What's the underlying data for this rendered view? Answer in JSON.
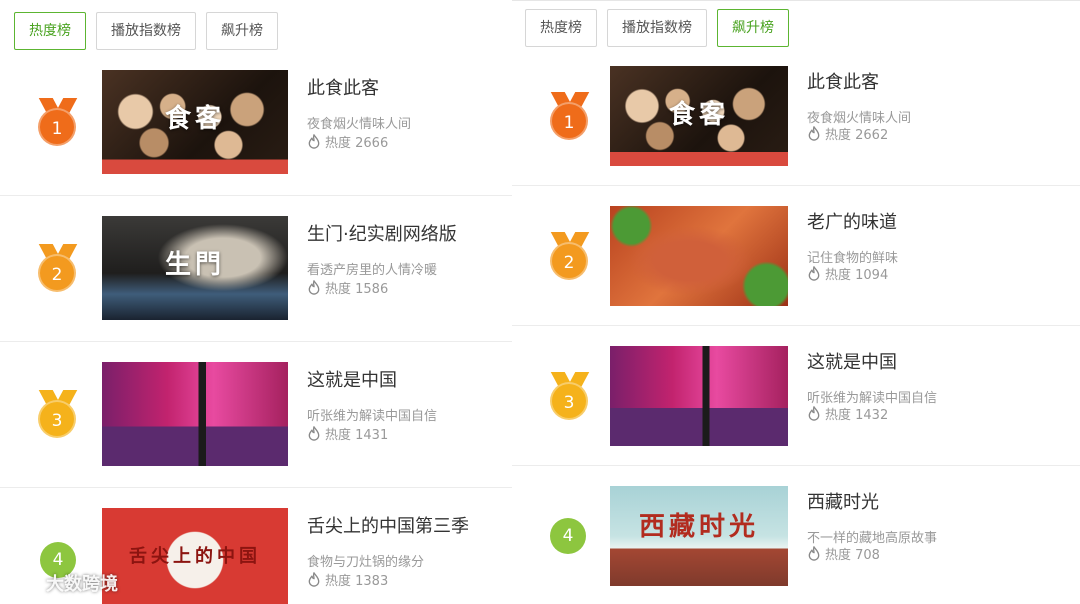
{
  "left_panel": {
    "tabs": [
      {
        "label": "热度榜",
        "active": true
      },
      {
        "label": "播放指数榜",
        "active": false
      },
      {
        "label": "飙升榜",
        "active": false
      }
    ],
    "items": [
      {
        "rank": "1",
        "rank_color": "#ef6c1a",
        "medal": true,
        "thumb_text": "食客",
        "title": "此食此客",
        "subtitle": "夜食烟火情味人间",
        "heat": "热度 2666"
      },
      {
        "rank": "2",
        "rank_color": "#f39a1f",
        "medal": true,
        "thumb_text": "生門",
        "title": "生门·纪实剧网络版",
        "subtitle": "看透产房里的人情冷暖",
        "heat": "热度 1586"
      },
      {
        "rank": "3",
        "rank_color": "#f5b21b",
        "medal": true,
        "thumb_text": "",
        "title": "这就是中国",
        "subtitle": "听张维为解读中国自信",
        "heat": "热度 1431"
      },
      {
        "rank": "4",
        "rank_color": "#8dc63f",
        "medal": false,
        "thumb_text": "舌尖上的中国",
        "title": "舌尖上的中国第三季",
        "subtitle": "食物与刀灶锅的缘分",
        "heat": "热度 1383"
      }
    ]
  },
  "right_panel": {
    "tabs": [
      {
        "label": "热度榜",
        "active": false
      },
      {
        "label": "播放指数榜",
        "active": false
      },
      {
        "label": "飙升榜",
        "active": true
      }
    ],
    "items": [
      {
        "rank": "1",
        "rank_color": "#ef6c1a",
        "medal": true,
        "thumb_text": "食客",
        "title": "此食此客",
        "subtitle": "夜食烟火情味人间",
        "heat": "热度 2662"
      },
      {
        "rank": "2",
        "rank_color": "#f39a1f",
        "medal": true,
        "thumb_text": "",
        "title": "老广的味道",
        "subtitle": "记住食物的鲜味",
        "heat": "热度 1094"
      },
      {
        "rank": "3",
        "rank_color": "#f5b21b",
        "medal": true,
        "thumb_text": "",
        "title": "这就是中国",
        "subtitle": "听张维为解读中国自信",
        "heat": "热度 1432"
      },
      {
        "rank": "4",
        "rank_color": "#8dc63f",
        "medal": false,
        "thumb_text": "西藏时光",
        "title": "西藏时光",
        "subtitle": "不一样的藏地高原故事",
        "heat": "热度 708"
      }
    ]
  },
  "watermark": {
    "text": "大数跨境",
    "icon": "chat-bubble-icon"
  },
  "icons": {
    "heat": "flame-icon"
  },
  "colors": {
    "accent": "#5cb531",
    "border": "#d6d6d6"
  }
}
